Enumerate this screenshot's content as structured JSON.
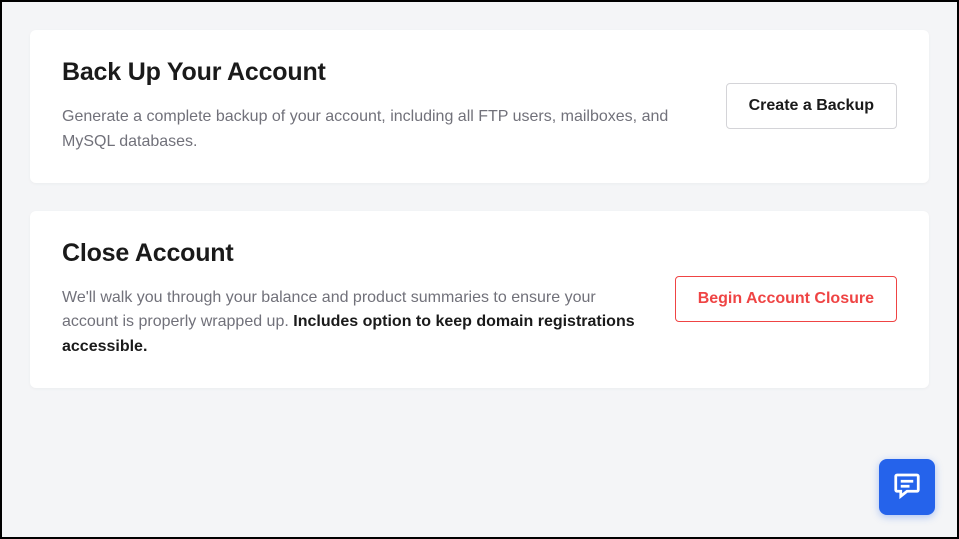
{
  "cards": {
    "backup": {
      "title": "Back Up Your Account",
      "description": "Generate a complete backup of your account, including all FTP users, mailboxes, and MySQL databases.",
      "button_label": "Create a Backup"
    },
    "close": {
      "title": "Close Account",
      "description_prefix": "We'll walk you through your balance and product summaries to ensure your account is properly wrapped up. ",
      "description_bold": "Includes option to keep domain registrations accessible.",
      "button_label": "Begin Account Closure"
    }
  },
  "icons": {
    "chat": "chat-icon"
  },
  "colors": {
    "danger": "#ef4444",
    "primary": "#2563eb",
    "text": "#1a1a1a",
    "muted": "#71717a",
    "border": "#d4d4d8",
    "bg": "#f4f5f7"
  }
}
